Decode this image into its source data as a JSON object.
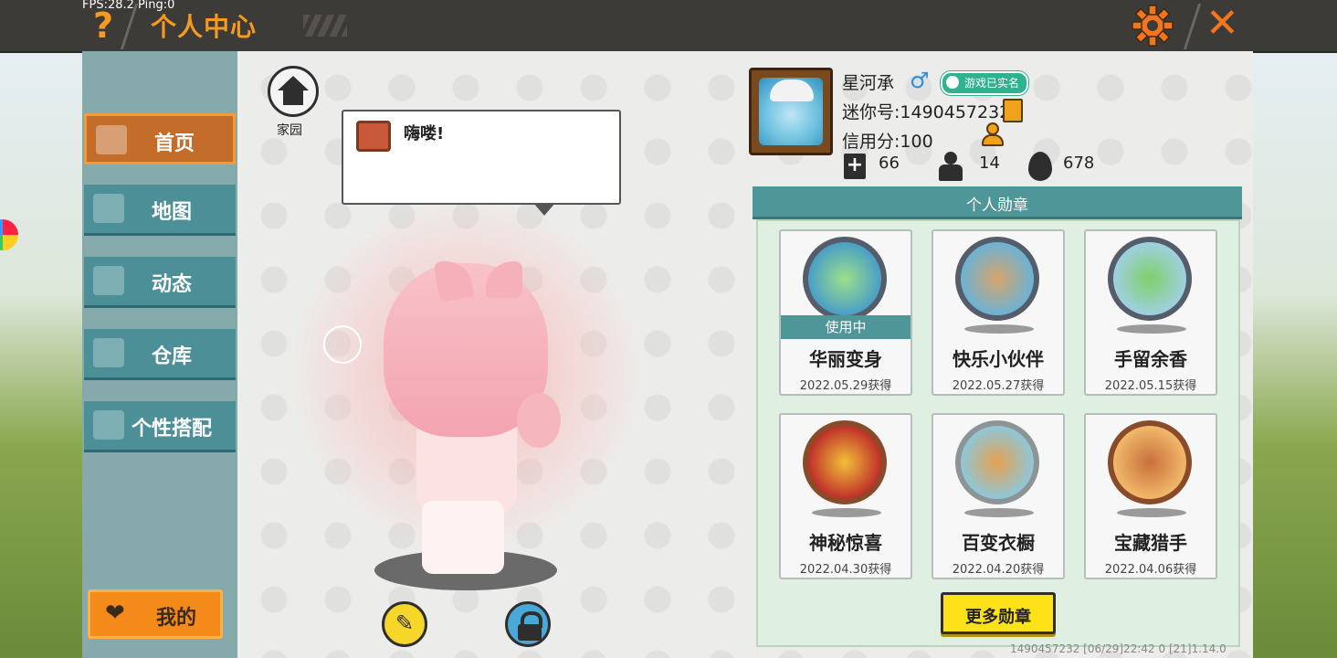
{
  "hud": {
    "fps": "FPS:28.2",
    "ping": "Ping:0"
  },
  "topbar": {
    "help": "?",
    "title": "个人中心",
    "settings_icon": "gear-icon",
    "close_icon": "close-icon",
    "close": "✕"
  },
  "nav": {
    "items": [
      {
        "label": "首页",
        "icon": "house-icon",
        "active": true
      },
      {
        "label": "地图",
        "icon": "map-icon",
        "active": false
      },
      {
        "label": "动态",
        "icon": "bell-icon",
        "active": false
      },
      {
        "label": "仓库",
        "icon": "warehouse-icon",
        "active": false
      },
      {
        "label": "个性搭配",
        "icon": "outfit-icon",
        "active": false
      }
    ],
    "mine_label": "我的"
  },
  "center": {
    "home_label": "家园",
    "greeting": "嗨喽!"
  },
  "profile": {
    "name": "星河承",
    "gender_symbol": "♂",
    "verified": "游戏已实名",
    "mini_id": "迷你号:1490457232",
    "credit": "信用分:100",
    "stats": {
      "friends": "66",
      "fans": "14",
      "popularity": "678"
    }
  },
  "medals": {
    "header": "个人勋章",
    "in_use_label": "使用中",
    "items": [
      {
        "name": "华丽变身",
        "date": "2022.05.29获得",
        "in_use": true,
        "style": "steel"
      },
      {
        "name": "快乐小伙伴",
        "date": "2022.05.27获得",
        "in_use": false,
        "style": "steel"
      },
      {
        "name": "手留余香",
        "date": "2022.05.15获得",
        "in_use": false,
        "style": "steel"
      },
      {
        "name": "神秘惊喜",
        "date": "2022.04.30获得",
        "in_use": false,
        "style": "bronze"
      },
      {
        "name": "百变衣橱",
        "date": "2022.04.20获得",
        "in_use": false,
        "style": "silver"
      },
      {
        "name": "宝藏猎手",
        "date": "2022.04.06获得",
        "in_use": false,
        "style": "bronze"
      }
    ],
    "more_label": "更多勋章"
  },
  "footer": "1490457232    [06/29]22:42 0  [21]1.14.0",
  "colors": {
    "accent_orange": "#f59a1e",
    "nav_teal": "#4c8f97",
    "medal_teal": "#4f9698",
    "button_yellow": "#ffe11a"
  }
}
